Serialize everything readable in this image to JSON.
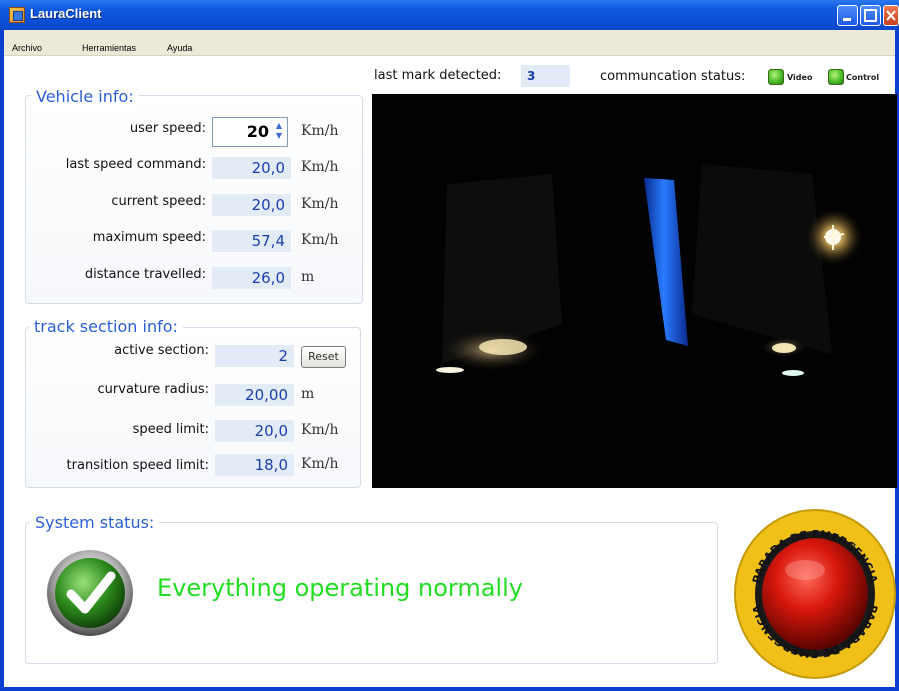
{
  "window": {
    "title": "LauraClient"
  },
  "menu": {
    "items": [
      "Archivo",
      "Herramientas",
      "Ayuda"
    ]
  },
  "top_bar": {
    "last_mark_label": "last mark detected:",
    "last_mark_value": "3",
    "comm_status_label": "communcation status:",
    "video_label": "Video",
    "control_label": "Control",
    "video_status_color": "#4bbf2a",
    "control_status_color": "#4bbf2a"
  },
  "vehicle_info": {
    "title": "Vehicle info:",
    "user_speed_label": "user speed:",
    "user_speed_value": "20",
    "user_speed_unit": "Km/h",
    "last_cmd_label": "last speed command:",
    "last_cmd_value": "20,0",
    "last_cmd_unit": "Km/h",
    "current_label": "current speed:",
    "current_value": "20,0",
    "current_unit": "Km/h",
    "max_label": "maximum speed:",
    "max_value": "57,4",
    "max_unit": "Km/h",
    "distance_label": "distance travelled:",
    "distance_value": "26,0",
    "distance_unit": "m"
  },
  "track_info": {
    "title": "track section info:",
    "active_label": "active section:",
    "active_value": "2",
    "reset_label": "Reset",
    "curvature_label": "curvature radius:",
    "curvature_value": "20,00",
    "curvature_unit": "m",
    "limit_label": "speed limit:",
    "limit_value": "20,0",
    "limit_unit": "Km/h",
    "transition_label": "transition speed limit:",
    "transition_value": "18,0",
    "transition_unit": "Km/h"
  },
  "system_status": {
    "title": "System status:",
    "message": "Everything operating normally",
    "icon": "check-icon"
  },
  "emergency": {
    "label_top": "PARADA DE EMERGENCIA",
    "label_bottom": "PARADA DE EMERGENCIA"
  }
}
